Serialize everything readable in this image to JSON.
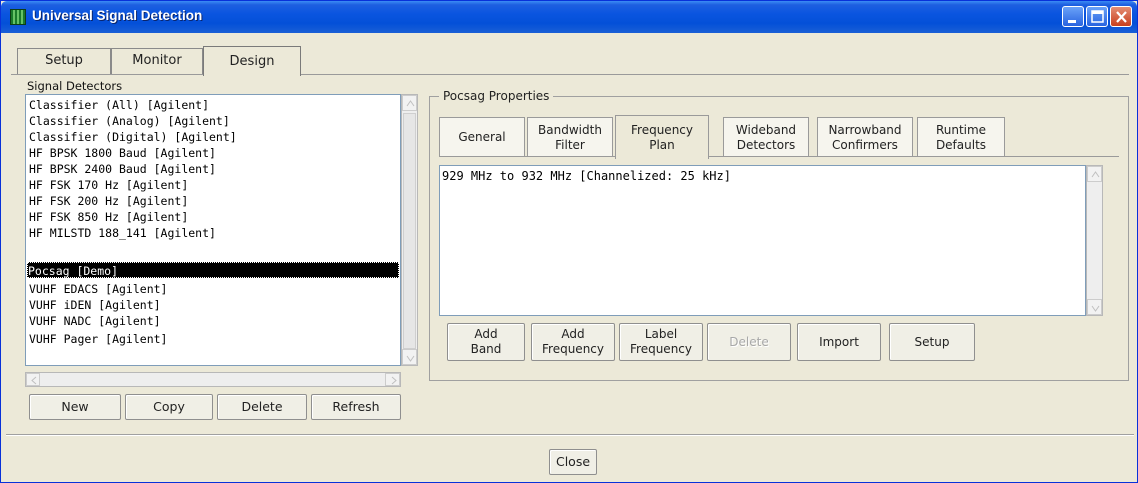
{
  "window": {
    "title": "Universal Signal Detection"
  },
  "tabs": [
    {
      "label": "Setup"
    },
    {
      "label": "Monitor"
    },
    {
      "label": "Design"
    }
  ],
  "active_tab": "Design",
  "detectors": {
    "label": "Signal Detectors",
    "items": [
      "Classifier (All) [Agilent]",
      "Classifier (Analog) [Agilent]",
      "Classifier (Digital) [Agilent]",
      "HF BPSK 1800 Baud [Agilent]",
      "HF BPSK 2400 Baud [Agilent]",
      "HF FSK 170 Hz [Agilent]",
      "HF FSK 200 Hz [Agilent]",
      "HF FSK 850 Hz [Agilent]",
      "HF MILSTD 188_141 [Agilent]",
      "Pocsag [Demo]",
      "VUHF EDACS [Agilent]",
      "VUHF iDEN [Agilent]",
      "VUHF NADC [Agilent]",
      "VUHF Pager [Agilent]"
    ],
    "selected": "Pocsag [Demo]",
    "buttons": {
      "new": "New",
      "copy": "Copy",
      "delete": "Delete",
      "refresh": "Refresh"
    }
  },
  "properties": {
    "title": "Pocsag Properties",
    "tabs": [
      {
        "line1": "General",
        "line2": ""
      },
      {
        "line1": "Bandwidth",
        "line2": "Filter"
      },
      {
        "line1": "Frequency",
        "line2": "Plan"
      },
      {
        "line1": "Wideband",
        "line2": "Detectors"
      },
      {
        "line1": "Narrowband",
        "line2": "Confirmers"
      },
      {
        "line1": "Runtime",
        "line2": "Defaults"
      }
    ],
    "active_tab": "Frequency Plan",
    "frequency_plan": [
      "929 MHz to 932 MHz [Channelized: 25 kHz]"
    ],
    "buttons": {
      "add_band": {
        "line1": "Add",
        "line2": "Band"
      },
      "add_frequency": {
        "line1": "Add",
        "line2": "Frequency"
      },
      "label_frequency": {
        "line1": "Label",
        "line2": "Frequency"
      },
      "delete": "Delete",
      "import": "Import",
      "setup": "Setup"
    }
  },
  "footer": {
    "close_label": "Close"
  }
}
